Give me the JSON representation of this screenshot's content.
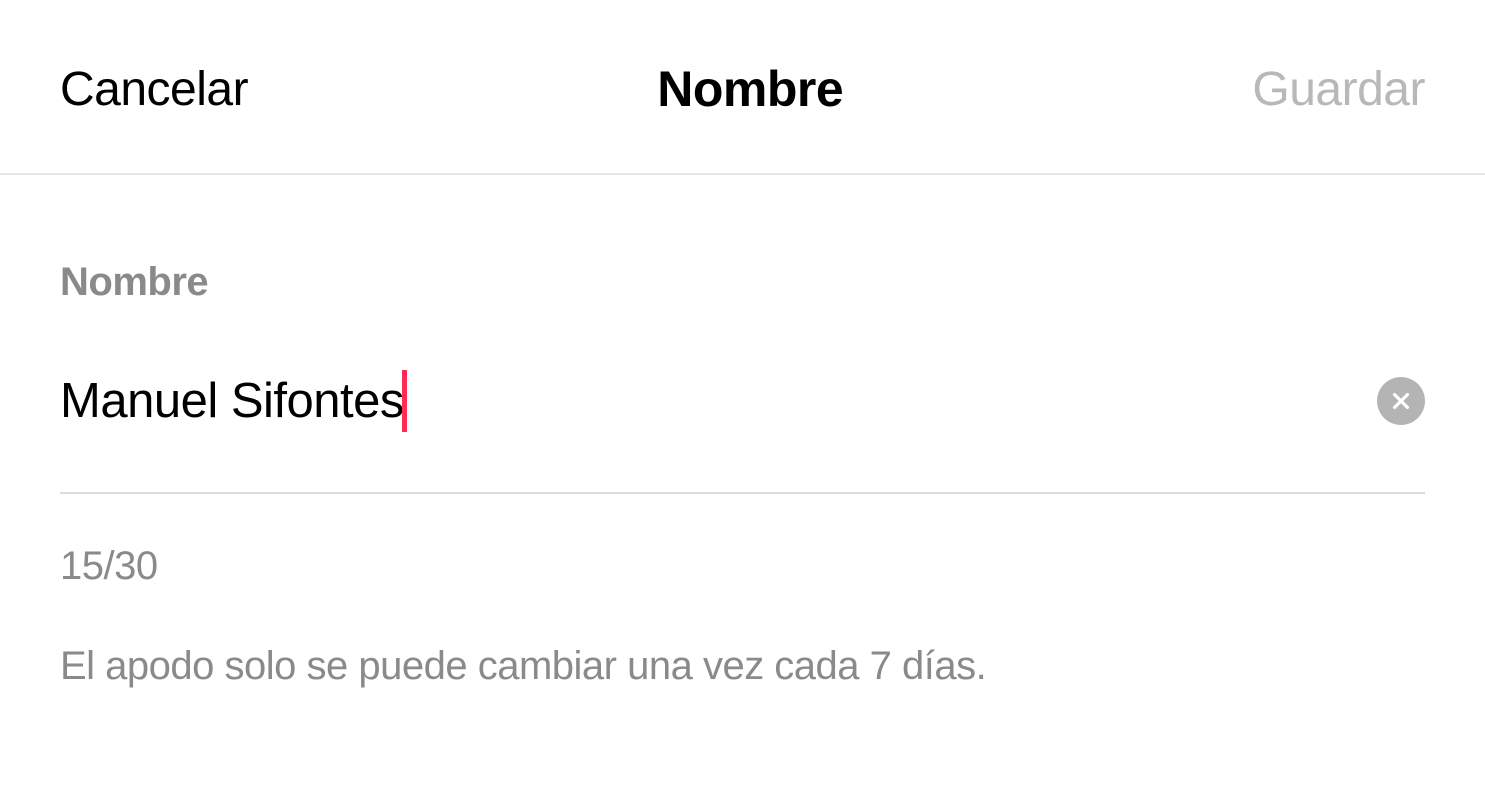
{
  "header": {
    "cancel_label": "Cancelar",
    "title": "Nombre",
    "save_label": "Guardar"
  },
  "form": {
    "field_label": "Nombre",
    "name_value": "Manuel Sifontes",
    "char_count": "15/30",
    "hint": "El apodo solo se puede cambiar una vez cada 7 días."
  }
}
